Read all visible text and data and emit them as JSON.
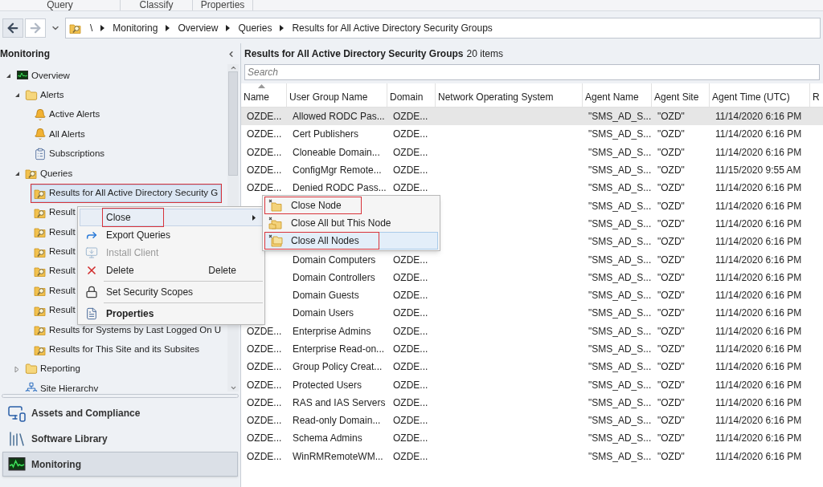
{
  "ribbon_groups": [
    "Query",
    "Classify",
    "Properties"
  ],
  "address_bar": {
    "path": [
      "\\",
      "Monitoring",
      "Overview",
      "Queries",
      "Results for All Active Directory Security Groups"
    ]
  },
  "navigation_pane": {
    "title": "Monitoring",
    "tree": [
      {
        "label": "Overview",
        "kind": "monitor",
        "expanded": true,
        "selected": false,
        "children": [
          {
            "label": "Alerts",
            "kind": "folder",
            "expanded": true,
            "selected": false,
            "children": [
              {
                "label": "Active Alerts",
                "kind": "bell",
                "selected": false
              },
              {
                "label": "All Alerts",
                "kind": "bell",
                "selected": false
              },
              {
                "label": "Subscriptions",
                "kind": "list",
                "selected": false
              }
            ]
          },
          {
            "label": "Queries",
            "kind": "query",
            "expanded": true,
            "selected": false,
            "children": [
              {
                "label": "Results for All Active Directory Security G",
                "kind": "query",
                "selected": true,
                "outlined": true
              },
              {
                "label": "Result",
                "kind": "query",
                "selected": false
              },
              {
                "label": "Result",
                "kind": "query",
                "selected": false
              },
              {
                "label": "Result",
                "kind": "query",
                "selected": false
              },
              {
                "label": "Result",
                "kind": "query",
                "selected": false
              },
              {
                "label": "Result",
                "kind": "query",
                "selected": false
              },
              {
                "label": "Result",
                "kind": "query",
                "selected": false
              },
              {
                "label": "Results for Systems by Last Logged On U",
                "kind": "query",
                "selected": false
              },
              {
                "label": "Results for This Site and its Subsites",
                "kind": "query",
                "selected": false
              }
            ]
          },
          {
            "label": "Reporting",
            "kind": "folder",
            "expanded": false,
            "selected": false
          },
          {
            "label": "Site Hierarchv",
            "kind": "site",
            "selected": false
          }
        ]
      }
    ],
    "workspaces": [
      {
        "label": "Assets and Compliance",
        "kind": "assets",
        "selected": false
      },
      {
        "label": "Software Library",
        "kind": "library",
        "selected": false
      },
      {
        "label": "Monitoring",
        "kind": "monitor",
        "selected": true
      }
    ]
  },
  "results": {
    "title": "Results for All Active Directory Security Groups",
    "count": "20 items",
    "search": {
      "placeholder": "Search"
    },
    "columns": [
      "Name",
      "User Group Name",
      "Domain",
      "Network Operating System",
      "Agent Name",
      "Agent Site",
      "Agent Time (UTC)",
      "R"
    ],
    "rows": [
      {
        "selected": true,
        "name": "OZDE...",
        "user_group_name": "Allowed RODC Pas...",
        "domain": "OZDE...",
        "agent_name": "\"SMS_AD_S...",
        "agent_site": "\"OZD\"",
        "agent_time": "11/14/2020 6:16 PM"
      },
      {
        "selected": false,
        "name": "OZDE...",
        "user_group_name": "Cert Publishers",
        "domain": "OZDE...",
        "agent_name": "\"SMS_AD_S...",
        "agent_site": "\"OZD\"",
        "agent_time": "11/14/2020 6:16 PM"
      },
      {
        "selected": false,
        "name": "OZDE...",
        "user_group_name": "Cloneable Domain...",
        "domain": "OZDE...",
        "agent_name": "\"SMS_AD_S...",
        "agent_site": "\"OZD\"",
        "agent_time": "11/14/2020 6:16 PM"
      },
      {
        "selected": false,
        "name": "OZDE...",
        "user_group_name": "ConfigMgr Remote...",
        "domain": "OZDE...",
        "agent_name": "\"SMS_AD_S...",
        "agent_site": "\"OZD\"",
        "agent_time": "11/15/2020 9:55 AM"
      },
      {
        "selected": false,
        "name": "OZDE...",
        "user_group_name": "Denied RODC Pass...",
        "domain": "OZDE...",
        "agent_name": "\"SMS_AD_S...",
        "agent_site": "\"OZD\"",
        "agent_time": "11/14/2020 6:16 PM"
      },
      {
        "selected": false,
        "agent_name": "\"SMS_AD_S...",
        "agent_site": "\"OZD\"",
        "agent_time": "11/14/2020 6:16 PM"
      },
      {
        "selected": false,
        "agent_name": "\"SMS_AD_S...",
        "agent_site": "\"OZD\"",
        "agent_time": "11/14/2020 6:16 PM"
      },
      {
        "selected": false,
        "agent_name": "\"SMS_AD_S...",
        "agent_site": "\"OZD\"",
        "agent_time": "11/14/2020 6:16 PM"
      },
      {
        "selected": false,
        "user_group_name": "Domain Computers",
        "domain": "OZDE...",
        "agent_name": "\"SMS_AD_S...",
        "agent_site": "\"OZD\"",
        "agent_time": "11/14/2020 6:16 PM"
      },
      {
        "selected": false,
        "user_group_name": "Domain Controllers",
        "domain": "OZDE...",
        "agent_name": "\"SMS_AD_S...",
        "agent_site": "\"OZD\"",
        "agent_time": "11/14/2020 6:16 PM"
      },
      {
        "selected": false,
        "user_group_name": "Domain Guests",
        "domain": "OZDE...",
        "agent_name": "\"SMS_AD_S...",
        "agent_site": "\"OZD\"",
        "agent_time": "11/14/2020 6:16 PM"
      },
      {
        "selected": false,
        "user_group_name": "Domain Users",
        "domain": "OZDE...",
        "agent_name": "\"SMS_AD_S...",
        "agent_site": "\"OZD\"",
        "agent_time": "11/14/2020 6:16 PM"
      },
      {
        "selected": false,
        "name": "OZDE...",
        "user_group_name": "Enterprise Admins",
        "domain": "OZDE...",
        "agent_name": "\"SMS_AD_S...",
        "agent_site": "\"OZD\"",
        "agent_time": "11/14/2020 6:16 PM"
      },
      {
        "selected": false,
        "name": "OZDE...",
        "user_group_name": "Enterprise Read-on...",
        "domain": "OZDE...",
        "agent_name": "\"SMS_AD_S...",
        "agent_site": "\"OZD\"",
        "agent_time": "11/14/2020 6:16 PM"
      },
      {
        "selected": false,
        "name": "OZDE...",
        "user_group_name": "Group Policy Creat...",
        "domain": "OZDE...",
        "agent_name": "\"SMS_AD_S...",
        "agent_site": "\"OZD\"",
        "agent_time": "11/14/2020 6:16 PM"
      },
      {
        "selected": false,
        "name": "OZDE...",
        "user_group_name": "Protected Users",
        "domain": "OZDE...",
        "agent_name": "\"SMS_AD_S...",
        "agent_site": "\"OZD\"",
        "agent_time": "11/14/2020 6:16 PM"
      },
      {
        "selected": false,
        "name": "OZDE...",
        "user_group_name": "RAS and IAS Servers",
        "domain": "OZDE...",
        "agent_name": "\"SMS_AD_S...",
        "agent_site": "\"OZD\"",
        "agent_time": "11/14/2020 6:16 PM"
      },
      {
        "selected": false,
        "name": "OZDE...",
        "user_group_name": "Read-only Domain...",
        "domain": "OZDE...",
        "agent_name": "\"SMS_AD_S...",
        "agent_site": "\"OZD\"",
        "agent_time": "11/14/2020 6:16 PM"
      },
      {
        "selected": false,
        "name": "OZDE...",
        "user_group_name": "Schema Admins",
        "domain": "OZDE...",
        "agent_name": "\"SMS_AD_S...",
        "agent_site": "\"OZD\"",
        "agent_time": "11/14/2020 6:16 PM"
      },
      {
        "selected": false,
        "name": "OZDE...",
        "user_group_name": "WinRMRemoteWM...",
        "domain": "OZDE...",
        "agent_name": "\"SMS_AD_S...",
        "agent_site": "\"OZD\"",
        "agent_time": "11/14/2020 6:16 PM"
      }
    ]
  },
  "context_menu": {
    "items": [
      {
        "kind": "command",
        "label": "Close",
        "has_submenu": true,
        "selected": true,
        "outlined": true,
        "disabled": false
      },
      {
        "kind": "command",
        "label": "Export Queries",
        "selected": false,
        "disabled": false
      },
      {
        "kind": "command",
        "label": "Install Client",
        "selected": false,
        "disabled": true
      },
      {
        "kind": "command",
        "label": "Delete",
        "shortcut": "Delete",
        "selected": false,
        "disabled": false
      },
      {
        "kind": "separator"
      },
      {
        "kind": "command",
        "label": "Set Security Scopes",
        "selected": false,
        "disabled": false
      },
      {
        "kind": "separator"
      },
      {
        "kind": "command",
        "label": "Properties",
        "default": true,
        "selected": false,
        "disabled": false
      }
    ]
  },
  "submenu": {
    "items": [
      {
        "label": "Close Node",
        "outlined": true,
        "selected": false
      },
      {
        "label": "Close All but This Node",
        "selected": false
      },
      {
        "label": "Close All Nodes",
        "outlined": true,
        "selected": true
      }
    ]
  }
}
